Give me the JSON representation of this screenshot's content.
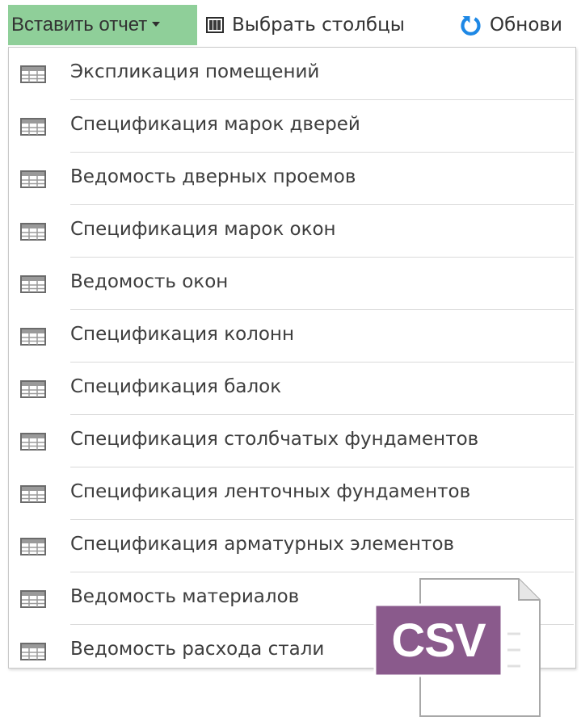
{
  "toolbar": {
    "insert_report": {
      "label": "Вставить отчет",
      "has_dropdown": true
    },
    "select_columns": {
      "label": "Выбрать столбцы"
    },
    "refresh": {
      "label": "Обнови"
    }
  },
  "dropdown": {
    "items": [
      {
        "label": "Экспликация помещений"
      },
      {
        "label": "Спецификация марок дверей"
      },
      {
        "label": "Ведомость дверных проемов"
      },
      {
        "label": "Спецификация марок окон"
      },
      {
        "label": "Ведомость окон"
      },
      {
        "label": "Спецификация колонн"
      },
      {
        "label": "Спецификация балок"
      },
      {
        "label": "Спецификация столбчатых фундаментов"
      },
      {
        "label": "Спецификация ленточных фундаментов"
      },
      {
        "label": "Спецификация арматурных элементов"
      },
      {
        "label": "Ведомость материалов"
      },
      {
        "label": "Ведомость расхода стали"
      }
    ]
  },
  "file_badge": {
    "text": "CSV"
  },
  "colors": {
    "insert_button_bg": "#8fcf99",
    "refresh_icon": "#1e88e5",
    "csv_badge": "#8a5a8c",
    "table_icon": "#6b6b6b"
  },
  "icons": {
    "menu_item": "table-icon",
    "select_columns": "columns-icon",
    "refresh": "refresh-icon",
    "file": "csv-file-icon"
  }
}
